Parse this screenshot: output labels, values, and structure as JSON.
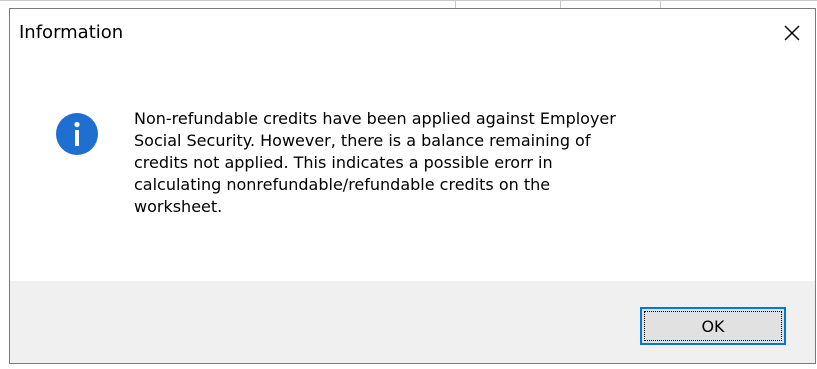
{
  "dialog": {
    "title": "Information",
    "close_icon": "close-icon",
    "icon": "info-icon",
    "message": "Non-refundable credits have been applied against Employer\nSocial Security. However, there is a balance remaining of\ncredits not applied. This indicates a possible erorr in\ncalculating nonrefundable/refundable credits on the\nworksheet.",
    "ok_label": "OK"
  },
  "colors": {
    "accent": "#0078d7",
    "footer_bg": "#f0f0f0",
    "button_bg": "#e1e1e1",
    "icon_blue": "#1e6fd0"
  }
}
